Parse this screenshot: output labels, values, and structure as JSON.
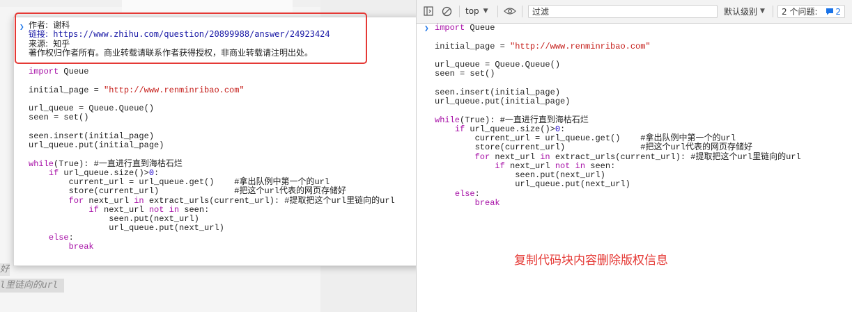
{
  "popup": {
    "copyright": {
      "author_label": "作者:",
      "author": "谢科",
      "link_label": "链接:",
      "link": "https://www.zhihu.com/question/20899988/answer/24923424",
      "source_label": "来源:",
      "source": "知乎",
      "notice": "著作权归作者所有。商业转载请联系作者获得授权，非商业转载请注明出处。"
    }
  },
  "code_lines": [
    "import Queue",
    "",
    "initial_page = \"http://www.renminribao.com\"",
    "",
    "url_queue = Queue.Queue()",
    "seen = set()",
    "",
    "seen.insert(initial_page)",
    "url_queue.put(initial_page)",
    "",
    "while(True): #一直进行直到海枯石烂",
    "    if url_queue.size()>0:",
    "        current_url = url_queue.get()    #拿出队例中第一个的url",
    "        store(current_url)               #把这个url代表的网页存储好",
    "        for next_url in extract_urls(current_url): #提取把这个url里链向的url",
    "            if next_url not in seen:",
    "                seen.put(next_url)",
    "                url_queue.put(next_url)",
    "    else:",
    "        break"
  ],
  "background": {
    "fragment1": "好",
    "fragment2": "l里链向的url"
  },
  "devtools": {
    "context": "top",
    "filter_placeholder": "过滤",
    "levels": "默认级别",
    "issues_label": "2 个问题:",
    "issues_count": "2"
  },
  "annotation": "复制代码块内容删除版权信息",
  "colors": {
    "highlight_border": "#e53935",
    "keyword": "#a711a7",
    "string": "#c41a16",
    "accent": "#1a73e8"
  }
}
